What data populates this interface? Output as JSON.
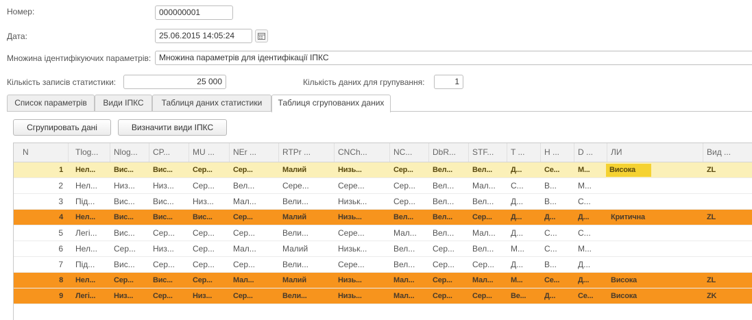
{
  "form": {
    "number_label": "Номер:",
    "number_value": "000000001",
    "date_label": "Дата:",
    "date_value": "25.06.2015 14:05:24",
    "paramset_label": "Множина ідентифікуючих параметрів:",
    "paramset_value": "Множина параметрів для ідентифікації ІПКС",
    "records_label": "Кількість записів статистики:",
    "records_value": "25 000",
    "group_label": "Кількість даних для групування:",
    "group_value": "1"
  },
  "tabs": [
    {
      "label": "Список параметрів",
      "active": false
    },
    {
      "label": "Види ІПКС",
      "active": false
    },
    {
      "label": "Таблиця даних статистики",
      "active": false
    },
    {
      "label": "Таблиця сгрупованих даних",
      "active": true
    }
  ],
  "buttons": {
    "group": "Сгрупировать дані",
    "define": "Визначити види ІПКС"
  },
  "table": {
    "headers": [
      "N",
      "Tlog...",
      "Nlog...",
      "CP...",
      "MU ...",
      "NEr ...",
      "RTPr ...",
      "CNCh...",
      "NC...",
      "DbR...",
      "STF...",
      "T ...",
      "H ...",
      "D ...",
      "ЛИ",
      "Вид ..."
    ],
    "rows": [
      {
        "state": "selected",
        "cells": [
          "1",
          "Нел...",
          "Вис...",
          "Вис...",
          "Сер...",
          "Сер...",
          "Малий",
          "Низь...",
          "Сер...",
          "Вел...",
          "Вел...",
          "Д...",
          "Се...",
          "М...",
          "Висока",
          "ZL"
        ]
      },
      {
        "state": "normal",
        "cells": [
          "2",
          "Нел...",
          "Низ...",
          "Низ...",
          "Сер...",
          "Вел...",
          "Сере...",
          "Сере...",
          "Сер...",
          "Вел...",
          "Мал...",
          "С...",
          "В...",
          "М...",
          "",
          ""
        ]
      },
      {
        "state": "normal",
        "cells": [
          "3",
          "Під...",
          "Вис...",
          "Вис...",
          "Низ...",
          "Мал...",
          "Вели...",
          "Низьк...",
          "Сер...",
          "Вел...",
          "Вел...",
          "Д...",
          "В...",
          "С...",
          "",
          ""
        ]
      },
      {
        "state": "highlight",
        "cells": [
          "4",
          "Нел...",
          "Вис...",
          "Вис...",
          "Вис...",
          "Сер...",
          "Малий",
          "Низь...",
          "Вел...",
          "Вел...",
          "Сер...",
          "Д...",
          "Д...",
          "Д...",
          "Критична",
          "ZL"
        ]
      },
      {
        "state": "normal",
        "cells": [
          "5",
          "Легі...",
          "Вис...",
          "Сер...",
          "Сер...",
          "Сер...",
          "Вели...",
          "Сере...",
          "Мал...",
          "Вел...",
          "Мал...",
          "Д...",
          "С...",
          "С...",
          "",
          ""
        ]
      },
      {
        "state": "normal",
        "cells": [
          "6",
          "Нел...",
          "Сер...",
          "Низ...",
          "Сер...",
          "Мал...",
          "Малий",
          "Низьк...",
          "Вел...",
          "Сер...",
          "Вел...",
          "М...",
          "С...",
          "М...",
          "",
          ""
        ]
      },
      {
        "state": "normal",
        "cells": [
          "7",
          "Під...",
          "Вис...",
          "Сер...",
          "Сер...",
          "Сер...",
          "Вели...",
          "Сере...",
          "Вел...",
          "Сер...",
          "Сер...",
          "Д...",
          "В...",
          "Д...",
          "",
          ""
        ]
      },
      {
        "state": "highlight",
        "cells": [
          "8",
          "Нел...",
          "Сер...",
          "Вис...",
          "Сер...",
          "Мал...",
          "Малий",
          "Низь...",
          "Мал...",
          "Сер...",
          "Мал...",
          "М...",
          "Се...",
          "Д...",
          "Висока",
          "ZL"
        ]
      },
      {
        "state": "highlight",
        "cells": [
          "9",
          "Легі...",
          "Низ...",
          "Сер...",
          "Низ...",
          "Сер...",
          "Вели...",
          "Низь...",
          "Мал...",
          "Сер...",
          "Сер...",
          "Ве...",
          "Д...",
          "Се...",
          "Висока",
          "ZK"
        ]
      }
    ]
  },
  "colors": {
    "selected_row": "#fbf0b8",
    "highlight_row": "#f7941d",
    "badge": "#f5d232"
  }
}
